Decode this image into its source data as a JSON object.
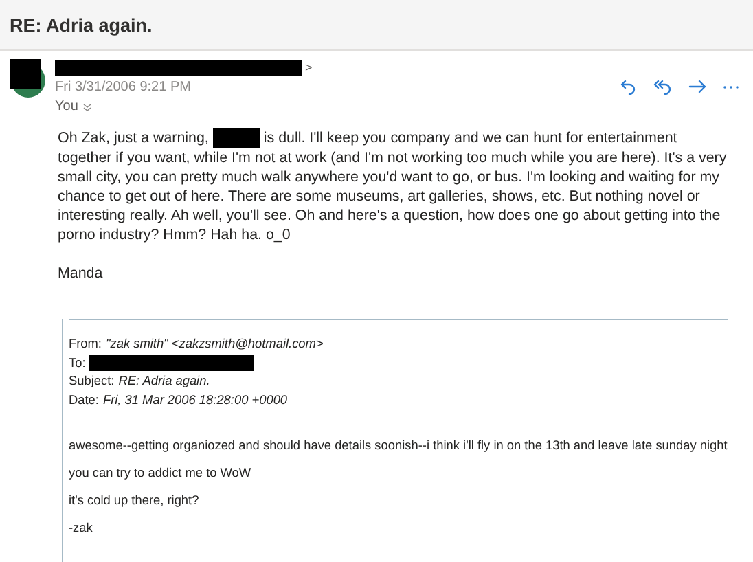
{
  "subject": "RE: Adria again.",
  "sender": {
    "name_suffix": ">",
    "date": "Fri 3/31/2006 9:21 PM",
    "recipient": "You"
  },
  "message": {
    "before_redaction": "Oh Zak, just a warning,",
    "after_redaction": "is dull. I'll keep you company and we can hunt for entertainment together if you want, while I'm not at work (and I'm not working too much while you are here). It's a very small city, you can pretty much walk anywhere you'd want to go, or bus. I'm looking and waiting for my chance to get out of here. There are some museums, art galleries, shows, etc. But nothing novel or interesting really. Ah well, you'll see. Oh and here's a question, how does one go about getting into the porno industry? Hmm? Hah ha. o_0",
    "signature": "Manda"
  },
  "quoted": {
    "headers": [
      {
        "label": "From:",
        "value": "\"zak smith\" <zakzsmith@hotmail.com>",
        "redacted": false
      },
      {
        "label": "To:",
        "redacted": true
      },
      {
        "label": "Subject:",
        "value": "RE: Adria again.",
        "redacted": false
      },
      {
        "label": "Date:",
        "value": "Fri, 31 Mar 2006 18:28:00 +0000",
        "redacted": false
      }
    ],
    "lines": [
      "awesome--getting organiozed and should have details soonish--i think i'll fly in on the 13th and leave late sunday night",
      "you can try to addict me to WoW",
      "it's cold up there, right?",
      "-zak"
    ]
  }
}
